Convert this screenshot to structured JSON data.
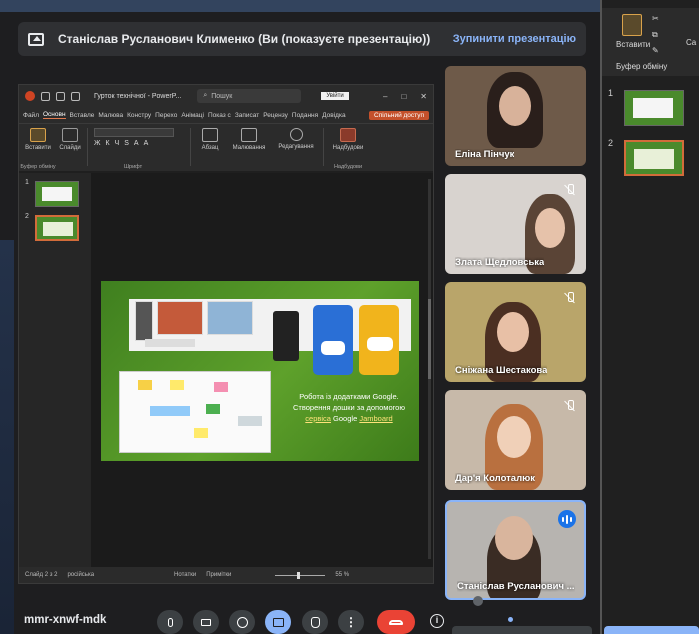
{
  "banner": {
    "title": "Станіслав Русланович Клименко (Ви (показуєте презентацію))",
    "stop_label": "Зупинити презентацію"
  },
  "ppt": {
    "file_name": "Гурток технічної - PowerP...",
    "search_placeholder": "Пошук",
    "login_label": "Увійти",
    "tabs": [
      "Файл",
      "Основн",
      "Вставле",
      "Малюва",
      "Констру",
      "Перехо",
      "Анімаці",
      "Показ с",
      "Записат",
      "Рецензу",
      "Подання",
      "Довідка"
    ],
    "share_label": "Спільний доступ",
    "ribbon": {
      "paste": "Вставити",
      "clipboard_group": "Буфер обміну",
      "slides": "Слайди",
      "font_group": "Шрифт",
      "paragraph": "Абзац",
      "drawing": "Малювання",
      "editing": "Редагування",
      "designer": "Надбудови",
      "addins_group": "Надбудови"
    },
    "thumb_numbers": [
      "1",
      "2"
    ],
    "slide_text": {
      "line1": "Робота із додатками Google.",
      "line2": "Створення дошки за допомогою",
      "link1": "сервіса",
      "mid": " Google ",
      "link2": "Jamboard"
    },
    "status": {
      "slide_counter": "Слайд 2 з 2",
      "language": "російська",
      "notes": "Нотатки",
      "comments": "Примітки",
      "zoom": "55 %"
    }
  },
  "participants": [
    {
      "name": "Еліна Пінчук",
      "muted": false
    },
    {
      "name": "Злата Щедловська",
      "muted": true
    },
    {
      "name": "Сніжана Шестакова",
      "muted": true
    },
    {
      "name": "Дар'я Колоталюк",
      "muted": true
    },
    {
      "name": "Станіслав Русланович ...",
      "speaking": true
    }
  ],
  "right_panel": {
    "paste": "Вставити",
    "clipboard": "Буфер обміну",
    "cut_short": "Ca",
    "thumb_numbers": [
      "1",
      "2"
    ]
  },
  "controls": {
    "meeting_code": "mmr-xnwf-mdk",
    "info_glyph": "i",
    "more_glyph": "⋮"
  },
  "colors": {
    "meet_accent": "#8ab4f8",
    "hangup": "#ea4335",
    "ppt_accent": "#c4502b",
    "slide_green": "#5ea12b"
  }
}
